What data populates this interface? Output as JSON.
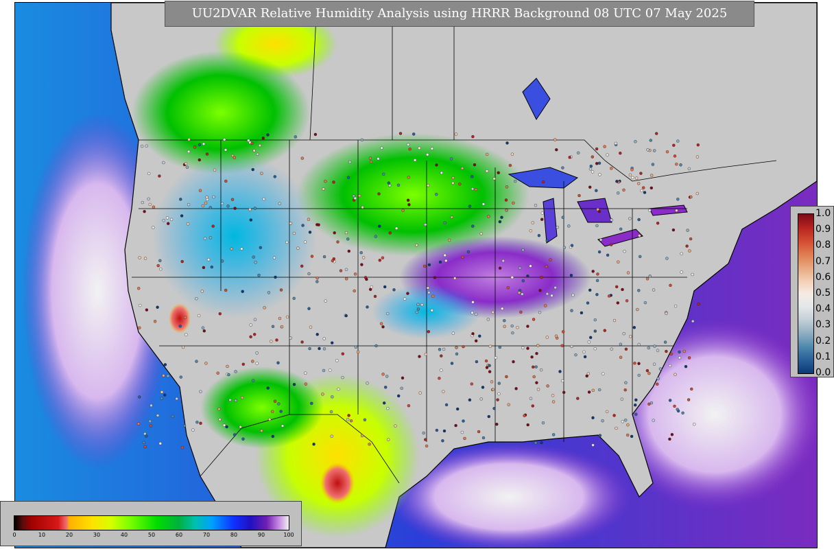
{
  "title": "UU2DVAR Relative Humidity Analysis using HRRR Background 08 UTC 07 May 2025",
  "map": {
    "field": "relative humidity",
    "region": "CONUS",
    "land_background": "#c8c8c8",
    "ocean_gradient": [
      "#7a2bbf",
      "#2a3fd8",
      "#0a80e8"
    ]
  },
  "observation_scale": {
    "ticks": [
      "1.0",
      "0.9",
      "0.8",
      "0.7",
      "0.6",
      "0.5",
      "0.4",
      "0.3",
      "0.2",
      "0.1",
      "0.0"
    ],
    "colors_top_to_bottom": [
      "#7a0c18",
      "#b5231f",
      "#d24a32",
      "#df7a4f",
      "#e6a77c",
      "#f3cdb4",
      "#f7ebe4",
      "#e3e7ea",
      "#c2ced6",
      "#8eaec2",
      "#4f88ad",
      "#285f98",
      "#0c3a77"
    ]
  },
  "rh_scale": {
    "ticks": [
      "0",
      "10",
      "20",
      "30",
      "40",
      "50",
      "60",
      "70",
      "80",
      "90",
      "100"
    ],
    "stops": [
      {
        "v": 0,
        "c": "#000000"
      },
      {
        "v": 3,
        "c": "#5a0b0b"
      },
      {
        "v": 6,
        "c": "#a00000"
      },
      {
        "v": 16,
        "c": "#d81818"
      },
      {
        "v": 19,
        "c": "#f07070"
      },
      {
        "v": 20,
        "c": "#ffb000"
      },
      {
        "v": 28,
        "c": "#ffe000"
      },
      {
        "v": 35,
        "c": "#d8ff00"
      },
      {
        "v": 42,
        "c": "#7cff00"
      },
      {
        "v": 52,
        "c": "#00dd00"
      },
      {
        "v": 60,
        "c": "#00b040"
      },
      {
        "v": 66,
        "c": "#00c0b0"
      },
      {
        "v": 72,
        "c": "#00a0ff"
      },
      {
        "v": 80,
        "c": "#1030ff"
      },
      {
        "v": 86,
        "c": "#2010c0"
      },
      {
        "v": 92,
        "c": "#7020b0"
      },
      {
        "v": 96,
        "c": "#c080e0"
      },
      {
        "v": 100,
        "c": "#f0f0f0"
      }
    ]
  }
}
